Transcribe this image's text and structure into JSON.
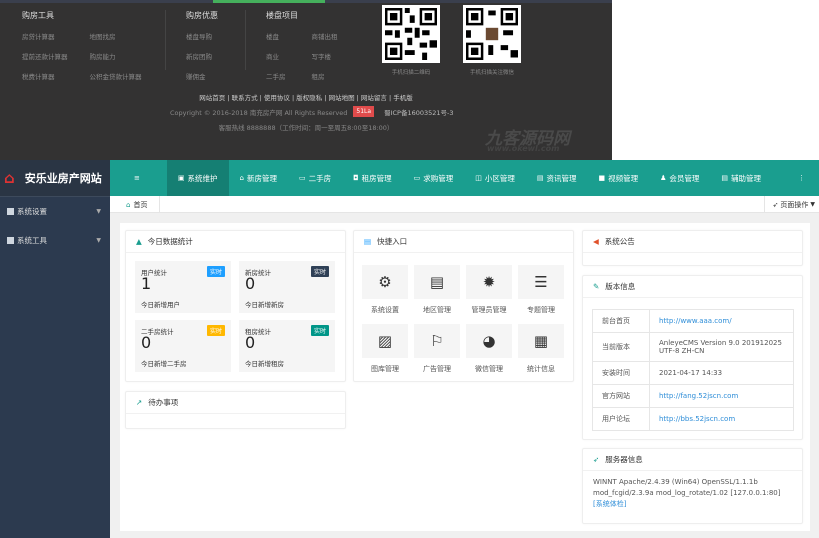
{
  "footer": {
    "cols": [
      {
        "title": "购房工具",
        "links": [
          "房贷计算器",
          "地图找房",
          "提前还款计算器",
          "购房能力",
          "税费计算器",
          "公积金贷款计算器"
        ]
      },
      {
        "title": "购房优惠",
        "links": [
          "楼盘导购",
          "新房团购",
          "赚佣金"
        ]
      },
      {
        "title": "楼盘项目",
        "links": [
          "楼盘",
          "商铺出租",
          "商业",
          "写字楼",
          "二手房",
          "租房"
        ]
      }
    ],
    "qr": [
      {
        "caption": "手机扫描二维码"
      },
      {
        "caption": "手机扫描关注微信"
      }
    ],
    "links": "网站首页 | 联系方式 | 使用协议 | 版权隐私 | 网站地图 | 网站留言 | 手机版",
    "copyright": "Copyright © 2016-2018 南充房产网 All Rights Reserved",
    "badge": "51La",
    "icp": "蜀ICP备16003521号-3",
    "hotline": "客服热线 8888888（工作时间：周一至周五8:00至18:00）",
    "watermark": "九客源码网",
    "watermark_url": "www.okewl.com"
  },
  "admin": {
    "site_name": "安乐业房产网站",
    "sidebar": [
      {
        "label": "系统设置"
      },
      {
        "label": "系统工具"
      }
    ],
    "nav": [
      {
        "icon": "≡",
        "label": ""
      },
      {
        "icon": "▣",
        "label": "系统维护"
      },
      {
        "icon": "⌂",
        "label": "新房管理"
      },
      {
        "icon": "▭",
        "label": "二手房"
      },
      {
        "icon": "◘",
        "label": "租房管理"
      },
      {
        "icon": "▭",
        "label": "求购管理"
      },
      {
        "icon": "◫",
        "label": "小区管理"
      },
      {
        "icon": "▤",
        "label": "资讯管理"
      },
      {
        "icon": "■",
        "label": "视频管理"
      },
      {
        "icon": "♟",
        "label": "会员管理"
      },
      {
        "icon": "▤",
        "label": "辅助管理"
      },
      {
        "icon": "⋮",
        "label": ""
      }
    ],
    "breadcrumb": "首页",
    "page_ops": "页面操作",
    "today": {
      "title": "今日数据统计",
      "stats": [
        {
          "label": "用户统计",
          "tag": "实时",
          "value": "1",
          "sub": "今日新增用户",
          "color": "#1e9fff"
        },
        {
          "label": "新房统计",
          "tag": "实时",
          "value": "0",
          "sub": "今日新增新房",
          "color": "#2f4056"
        },
        {
          "label": "二手房统计",
          "tag": "实时",
          "value": "0",
          "sub": "今日新增二手房",
          "color": "#ffb800"
        },
        {
          "label": "租房统计",
          "tag": "实时",
          "value": "0",
          "sub": "今日新增租房",
          "color": "#009688"
        }
      ]
    },
    "todo": {
      "title": "待办事项"
    },
    "quick": {
      "title": "快捷入口",
      "items": [
        {
          "icon": "⚙",
          "label": "系统设置"
        },
        {
          "icon": "▤",
          "label": "地区管理"
        },
        {
          "icon": "✹",
          "label": "管理员管理"
        },
        {
          "icon": "☰",
          "label": "专题管理"
        },
        {
          "icon": "▨",
          "label": "图库管理"
        },
        {
          "icon": "⚐",
          "label": "广告管理"
        },
        {
          "icon": "◕",
          "label": "微信管理"
        },
        {
          "icon": "▦",
          "label": "统计信息"
        }
      ]
    },
    "notice": {
      "title": "系统公告"
    },
    "version": {
      "title": "版本信息",
      "rows": [
        {
          "k": "前台首页",
          "v": "http://www.aaa.com/",
          "link": true
        },
        {
          "k": "当前版本",
          "v": "AnleyeCMS Version 9.0 201912025 UTF-8 ZH-CN",
          "link": false
        },
        {
          "k": "安装时间",
          "v": "2021-04-17 14:33",
          "link": false
        },
        {
          "k": "官方网站",
          "v": "http://fang.52jscn.com",
          "link": true
        },
        {
          "k": "用户论坛",
          "v": "http://bbs.52jscn.com",
          "link": true
        }
      ]
    },
    "server": {
      "title": "服务器信息",
      "text": "WINNT Apache/2.4.39 (Win64) OpenSSL/1.1.1b mod_fcgid/2.3.9a mod_log_rotate/1.02 [127.0.0.1:80]",
      "check": "[系统体检]"
    }
  }
}
